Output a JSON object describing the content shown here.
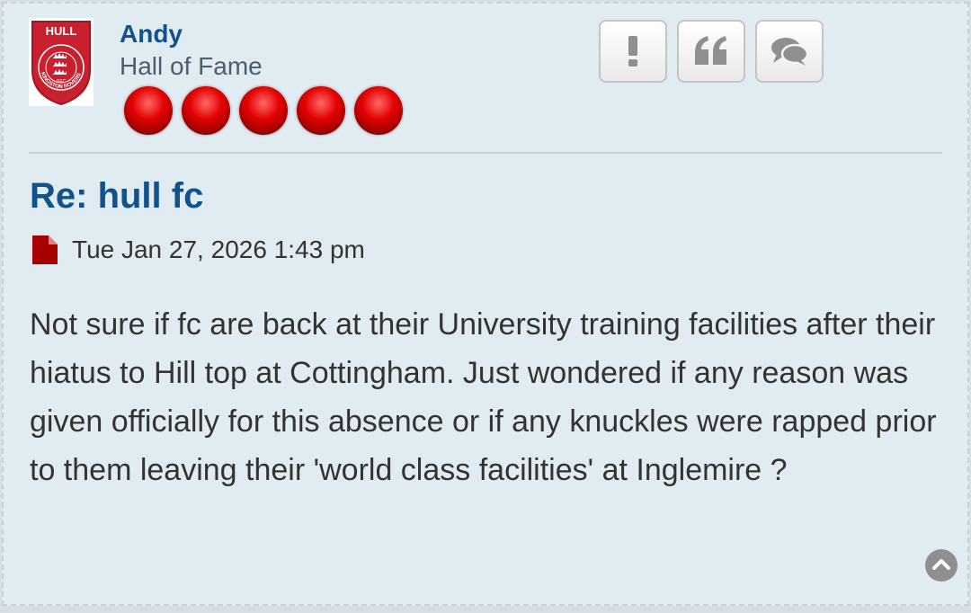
{
  "author": {
    "name": "Andy",
    "rank": "Hall of Fame",
    "rank_stars": 5,
    "avatar": {
      "top_text": "HULL",
      "ring_text": "KINGSTON ROVERS",
      "badge_text": "RFC",
      "color": "#c8202f"
    }
  },
  "actions": [
    {
      "icon": "exclamation-icon",
      "label": "Report this post"
    },
    {
      "icon": "quote-icon",
      "label": "Reply with quotations"
    },
    {
      "icon": "chat-bubbles-icon",
      "label": "Private message"
    }
  ],
  "post": {
    "title": "Re: hull fc",
    "date": "Tue Jan 27, 2026 1:43 pm",
    "body": "Not sure if fc are back at their University training facilities after their hiatus to Hill top at Cottingham. Just wondered if any reason was given officially for this absence or if any knuckles were rapped prior to them leaving their 'world class facilities' at Inglemire ?"
  },
  "colors": {
    "post_bg": "#e1ebf2",
    "link": "#105289",
    "text": "#333333",
    "rank_dot": "#e40000",
    "file_icon": "#a60000"
  }
}
